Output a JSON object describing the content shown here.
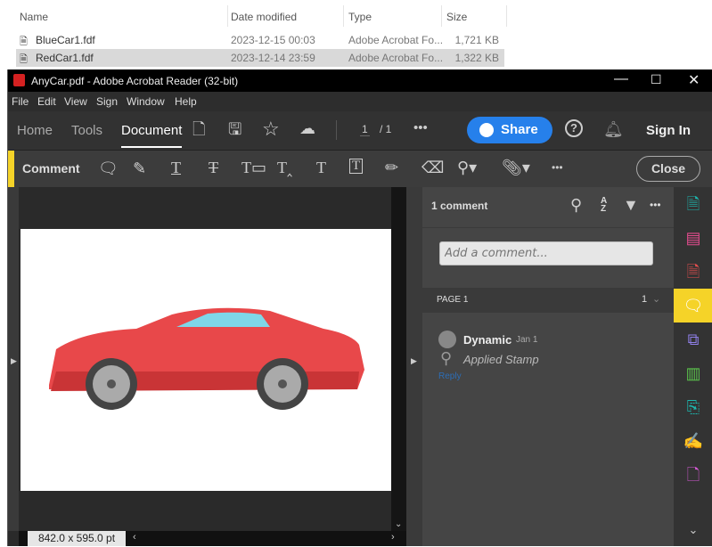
{
  "explorer": {
    "columns": [
      "Name",
      "Date modified",
      "Type",
      "Size"
    ],
    "files": [
      {
        "name": "BlueCar1.fdf",
        "date": "2023-12-15 00:03",
        "type": "Adobe Acrobat Fo...",
        "size": "1,721 KB"
      },
      {
        "name": "RedCar1.fdf",
        "date": "2023-12-14 23:59",
        "type": "Adobe Acrobat Fo...",
        "size": "1,322 KB"
      }
    ]
  },
  "window": {
    "title": "AnyCar.pdf - Adobe Acrobat Reader (32-bit)"
  },
  "menu": [
    "File",
    "Edit",
    "View",
    "Sign",
    "Window",
    "Help"
  ],
  "toolbar": {
    "tabs": [
      "Home",
      "Tools",
      "Document"
    ],
    "page_current": "1",
    "page_total": "/ 1",
    "share": "Share",
    "sign_in": "Sign In"
  },
  "comment_bar": {
    "label": "Comment",
    "close": "Close"
  },
  "panel": {
    "count": "1 comment",
    "placeholder": "Add a comment...",
    "page_label": "PAGE 1",
    "page_count": "1",
    "comment": {
      "author": "Dynamic",
      "date": "Jan 1",
      "text": "Applied Stamp",
      "reply": "Reply"
    }
  },
  "status": {
    "page_size": "842.0 x 595.0 pt"
  },
  "colors": {
    "accent": "#2680eb",
    "comment_yellow": "#f5d328"
  }
}
